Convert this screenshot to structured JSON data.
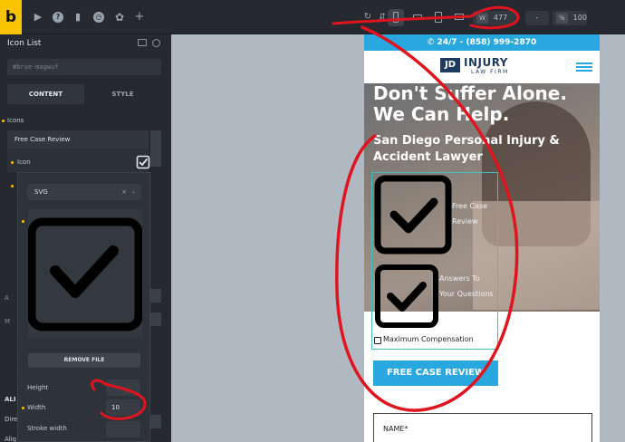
{
  "topbar": {
    "logo": "b",
    "width_label": "W",
    "width_value": "477",
    "height_value": "-",
    "zoom_label": "%",
    "zoom_value": "100"
  },
  "panel": {
    "title": "Icon List",
    "element_id": "#brxe-magwuf",
    "tabs": [
      "CONTENT",
      "STYLE"
    ],
    "icons_label": "Icons",
    "repeater_item": "Free Case Review",
    "icon_label": "Icon",
    "icon_checked": true,
    "select_value": "SVG",
    "remove_button": "REMOVE FILE",
    "height_label": "Height",
    "width_label": "Width",
    "width_value": "10",
    "stroke_label": "Stroke width"
  },
  "site": {
    "phone": "24/7 - (858) 999-2870",
    "logo_main": "JD",
    "logo_title": "INJURY",
    "logo_sub": "LAW FIRM",
    "headline": "Don't Suffer Alone. We Can Help.",
    "subheadline": "San Diego Personal Injury & Accident Lawyer",
    "items": [
      "Free Case Review",
      "Answers To Your Questions",
      "Maximum Compensation"
    ],
    "cta": "FREE CASE REVIEW",
    "name_field": "NAME*"
  },
  "colors": {
    "brand_yellow": "#f8c400",
    "accent_blue": "#29a8e0",
    "annotation_red": "#e0141e"
  }
}
